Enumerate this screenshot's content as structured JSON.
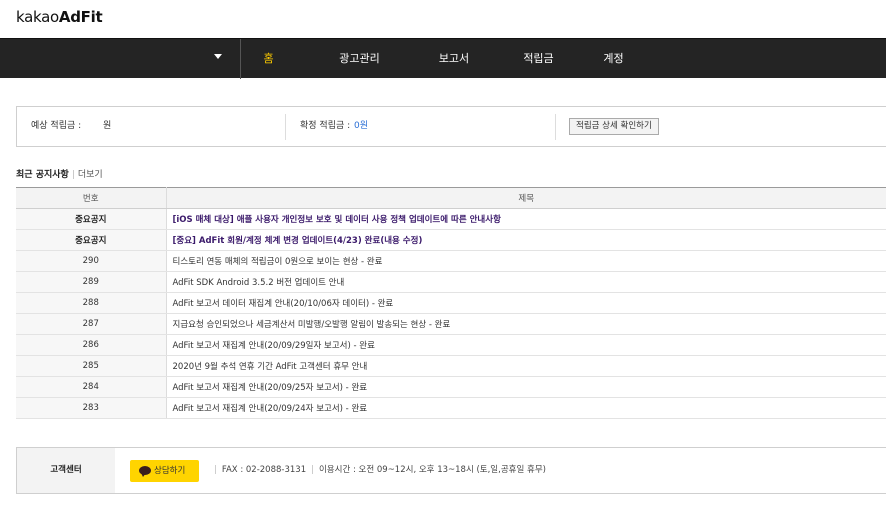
{
  "header": {
    "logo_light": "kakao",
    "logo_bold": "AdFit"
  },
  "nav": {
    "account_name": "",
    "items": [
      {
        "label": "홈",
        "active": true
      },
      {
        "label": "광고관리",
        "active": false
      },
      {
        "label": "보고서",
        "active": false
      },
      {
        "label": "적립금",
        "active": false
      },
      {
        "label": "계정",
        "active": false
      }
    ]
  },
  "summary": {
    "expected_label": "예상 적립금 :",
    "expected_value": "원",
    "confirmed_label": "확정 적립금 :",
    "confirmed_value": "0원",
    "detail_button": "적립금 상세 확인하기"
  },
  "notices": {
    "title": "최근 공지사항",
    "more": "더보기",
    "columns": {
      "no": "번호",
      "title": "제목"
    },
    "rows": [
      {
        "no": "중요공지",
        "title": "[iOS 매체 대상] 애플 사용자 개인정보 보호 및 데이터 사용 정책 업데이트에 따른 안내사항",
        "important": true
      },
      {
        "no": "중요공지",
        "title": "[중요] AdFit 회원/계정 체계 변경 업데이트(4/23) 완료(내용 수정)",
        "important": true
      },
      {
        "no": "290",
        "title": "티스토리 연동 매체의 적립금이 0원으로 보이는 현상 - 완료",
        "important": false
      },
      {
        "no": "289",
        "title": "AdFit SDK Android 3.5.2 버전 업데이트 안내",
        "important": false
      },
      {
        "no": "288",
        "title": "AdFit 보고서 데이터 재집계 안내(20/10/06자 데이터) - 완료",
        "important": false
      },
      {
        "no": "287",
        "title": "지급요청 승인되었으나 세금계산서 미발행/오발행 알림이 발송되는 현상 - 완료",
        "important": false
      },
      {
        "no": "286",
        "title": "AdFit 보고서 재집계 안내(20/09/29일자 보고서) - 완료",
        "important": false
      },
      {
        "no": "285",
        "title": "2020년 9월 추석 연휴 기간 AdFit 고객센터 휴무 안내",
        "important": false
      },
      {
        "no": "284",
        "title": "AdFit 보고서 재집계 안내(20/09/25자 보고서) - 완료",
        "important": false
      },
      {
        "no": "283",
        "title": "AdFit 보고서 재집계 안내(20/09/24자 보고서) - 완료",
        "important": false
      }
    ]
  },
  "footer": {
    "label": "고객센터",
    "chat_button": "상담하기",
    "chat_icon": "speech-bubble-icon",
    "fax": "FAX : 02-2088-3131",
    "hours": "이용시간 : 오전 09~12시, 오후 13~18시 (토,일,공휴일 휴무)"
  },
  "colors": {
    "nav_bg": "#242424",
    "nav_active": "#ffcd00",
    "link_blue": "#2b6fd6",
    "kakao_yellow": "#ffd400"
  }
}
